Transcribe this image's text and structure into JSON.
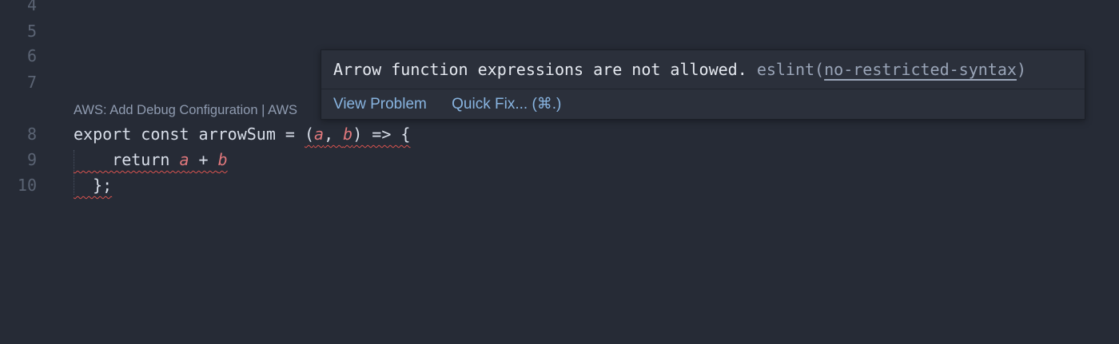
{
  "gutter": {
    "lines": [
      "4",
      "5",
      "6",
      "7",
      "8",
      "9",
      "10"
    ]
  },
  "codelens": {
    "text": "AWS: Add Debug Configuration | AWS"
  },
  "code": {
    "line8": {
      "before": "export const arrowSum = ",
      "open_paren": "(",
      "param_a": "a",
      "comma": ", ",
      "param_b": "b",
      "after": ") => {"
    },
    "line9": {
      "keyword": "    return ",
      "a": "a",
      "plus": " + ",
      "b": "b"
    },
    "line10": {
      "text": "  };"
    }
  },
  "hover": {
    "message": "Arrow function expressions are not allowed.",
    "source": "eslint(",
    "rule": "no-restricted-syntax",
    "source_close": ")",
    "actions": {
      "view_problem": "View Problem",
      "quick_fix": "Quick Fix... (⌘.)"
    }
  },
  "colors": {
    "background": "#262b36",
    "error_squiggle": "#d9534f",
    "link": "#88b4e0",
    "parameter": "#e0787c"
  }
}
